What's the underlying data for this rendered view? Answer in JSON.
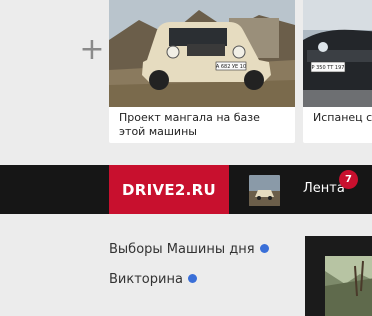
{
  "add_button": {
    "glyph": "+"
  },
  "cards": [
    {
      "caption": "Проект мангала на базе этой машины",
      "plate": "А 682 УЕ 10"
    },
    {
      "caption": "Испанец с",
      "plate": "Р 350 ТТ 197"
    }
  ],
  "navbar": {
    "logo": "DRIVE2.RU",
    "feed_label": "Лента",
    "feed_count": "7"
  },
  "sidebar": {
    "links": [
      {
        "label": "Выборы Машины дня"
      },
      {
        "label": "Викторина"
      }
    ]
  },
  "colors": {
    "brand_red": "#c8102e",
    "navbar_bg": "#161616",
    "page_bg": "#ececec",
    "dot_blue": "#3a6fd8"
  }
}
